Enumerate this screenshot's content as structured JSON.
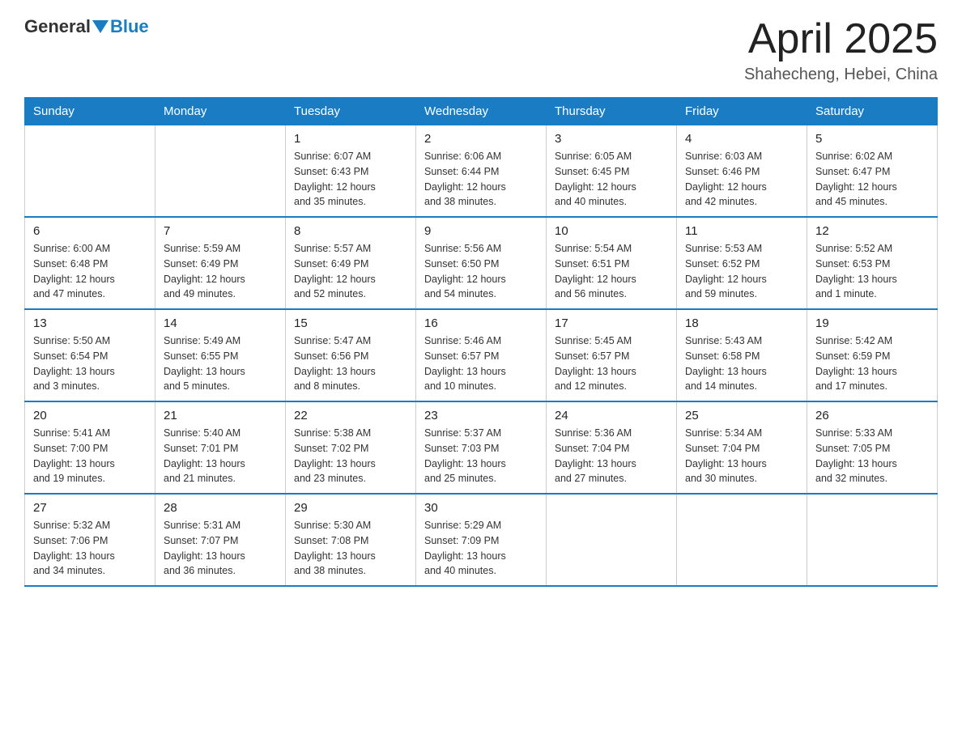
{
  "logo": {
    "general": "General",
    "blue": "Blue",
    "sub": ""
  },
  "header": {
    "month": "April 2025",
    "location": "Shahecheng, Hebei, China"
  },
  "weekdays": [
    "Sunday",
    "Monday",
    "Tuesday",
    "Wednesday",
    "Thursday",
    "Friday",
    "Saturday"
  ],
  "weeks": [
    [
      {
        "day": "",
        "info": ""
      },
      {
        "day": "",
        "info": ""
      },
      {
        "day": "1",
        "info": "Sunrise: 6:07 AM\nSunset: 6:43 PM\nDaylight: 12 hours\nand 35 minutes."
      },
      {
        "day": "2",
        "info": "Sunrise: 6:06 AM\nSunset: 6:44 PM\nDaylight: 12 hours\nand 38 minutes."
      },
      {
        "day": "3",
        "info": "Sunrise: 6:05 AM\nSunset: 6:45 PM\nDaylight: 12 hours\nand 40 minutes."
      },
      {
        "day": "4",
        "info": "Sunrise: 6:03 AM\nSunset: 6:46 PM\nDaylight: 12 hours\nand 42 minutes."
      },
      {
        "day": "5",
        "info": "Sunrise: 6:02 AM\nSunset: 6:47 PM\nDaylight: 12 hours\nand 45 minutes."
      }
    ],
    [
      {
        "day": "6",
        "info": "Sunrise: 6:00 AM\nSunset: 6:48 PM\nDaylight: 12 hours\nand 47 minutes."
      },
      {
        "day": "7",
        "info": "Sunrise: 5:59 AM\nSunset: 6:49 PM\nDaylight: 12 hours\nand 49 minutes."
      },
      {
        "day": "8",
        "info": "Sunrise: 5:57 AM\nSunset: 6:49 PM\nDaylight: 12 hours\nand 52 minutes."
      },
      {
        "day": "9",
        "info": "Sunrise: 5:56 AM\nSunset: 6:50 PM\nDaylight: 12 hours\nand 54 minutes."
      },
      {
        "day": "10",
        "info": "Sunrise: 5:54 AM\nSunset: 6:51 PM\nDaylight: 12 hours\nand 56 minutes."
      },
      {
        "day": "11",
        "info": "Sunrise: 5:53 AM\nSunset: 6:52 PM\nDaylight: 12 hours\nand 59 minutes."
      },
      {
        "day": "12",
        "info": "Sunrise: 5:52 AM\nSunset: 6:53 PM\nDaylight: 13 hours\nand 1 minute."
      }
    ],
    [
      {
        "day": "13",
        "info": "Sunrise: 5:50 AM\nSunset: 6:54 PM\nDaylight: 13 hours\nand 3 minutes."
      },
      {
        "day": "14",
        "info": "Sunrise: 5:49 AM\nSunset: 6:55 PM\nDaylight: 13 hours\nand 5 minutes."
      },
      {
        "day": "15",
        "info": "Sunrise: 5:47 AM\nSunset: 6:56 PM\nDaylight: 13 hours\nand 8 minutes."
      },
      {
        "day": "16",
        "info": "Sunrise: 5:46 AM\nSunset: 6:57 PM\nDaylight: 13 hours\nand 10 minutes."
      },
      {
        "day": "17",
        "info": "Sunrise: 5:45 AM\nSunset: 6:57 PM\nDaylight: 13 hours\nand 12 minutes."
      },
      {
        "day": "18",
        "info": "Sunrise: 5:43 AM\nSunset: 6:58 PM\nDaylight: 13 hours\nand 14 minutes."
      },
      {
        "day": "19",
        "info": "Sunrise: 5:42 AM\nSunset: 6:59 PM\nDaylight: 13 hours\nand 17 minutes."
      }
    ],
    [
      {
        "day": "20",
        "info": "Sunrise: 5:41 AM\nSunset: 7:00 PM\nDaylight: 13 hours\nand 19 minutes."
      },
      {
        "day": "21",
        "info": "Sunrise: 5:40 AM\nSunset: 7:01 PM\nDaylight: 13 hours\nand 21 minutes."
      },
      {
        "day": "22",
        "info": "Sunrise: 5:38 AM\nSunset: 7:02 PM\nDaylight: 13 hours\nand 23 minutes."
      },
      {
        "day": "23",
        "info": "Sunrise: 5:37 AM\nSunset: 7:03 PM\nDaylight: 13 hours\nand 25 minutes."
      },
      {
        "day": "24",
        "info": "Sunrise: 5:36 AM\nSunset: 7:04 PM\nDaylight: 13 hours\nand 27 minutes."
      },
      {
        "day": "25",
        "info": "Sunrise: 5:34 AM\nSunset: 7:04 PM\nDaylight: 13 hours\nand 30 minutes."
      },
      {
        "day": "26",
        "info": "Sunrise: 5:33 AM\nSunset: 7:05 PM\nDaylight: 13 hours\nand 32 minutes."
      }
    ],
    [
      {
        "day": "27",
        "info": "Sunrise: 5:32 AM\nSunset: 7:06 PM\nDaylight: 13 hours\nand 34 minutes."
      },
      {
        "day": "28",
        "info": "Sunrise: 5:31 AM\nSunset: 7:07 PM\nDaylight: 13 hours\nand 36 minutes."
      },
      {
        "day": "29",
        "info": "Sunrise: 5:30 AM\nSunset: 7:08 PM\nDaylight: 13 hours\nand 38 minutes."
      },
      {
        "day": "30",
        "info": "Sunrise: 5:29 AM\nSunset: 7:09 PM\nDaylight: 13 hours\nand 40 minutes."
      },
      {
        "day": "",
        "info": ""
      },
      {
        "day": "",
        "info": ""
      },
      {
        "day": "",
        "info": ""
      }
    ]
  ]
}
